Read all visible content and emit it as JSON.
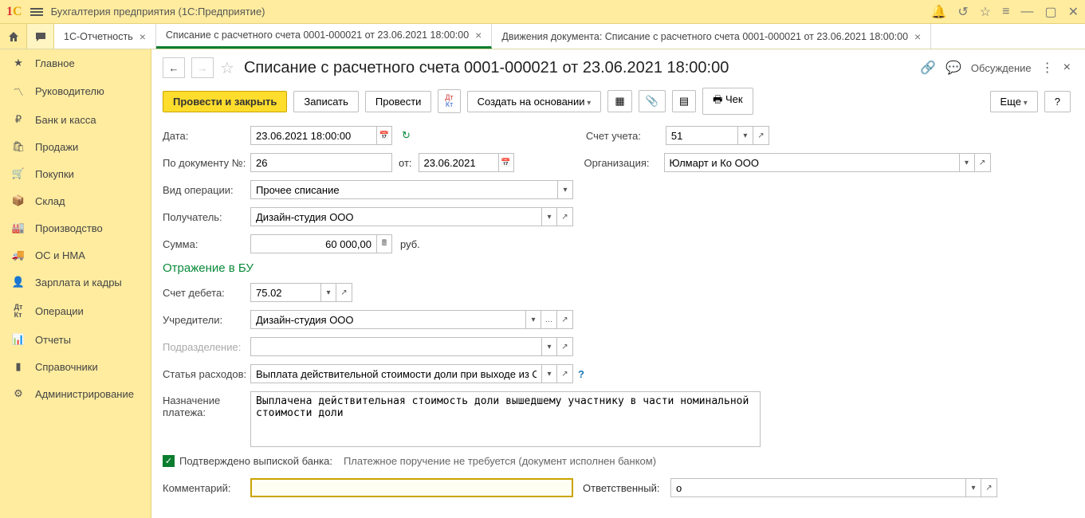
{
  "titlebar": {
    "app_name": "Бухгалтерия предприятия  (1С:Предприятие)"
  },
  "tabs": {
    "t1": "1С-Отчетность",
    "t2": "Списание с расчетного счета 0001-000021 от 23.06.2021 18:00:00",
    "t3": "Движения документа: Списание с расчетного счета 0001-000021 от 23.06.2021 18:00:00"
  },
  "sidebar": {
    "i0": "Главное",
    "i1": "Руководителю",
    "i2": "Банк и касса",
    "i3": "Продажи",
    "i4": "Покупки",
    "i5": "Склад",
    "i6": "Производство",
    "i7": "ОС и НМА",
    "i8": "Зарплата и кадры",
    "i9": "Операции",
    "i10": "Отчеты",
    "i11": "Справочники",
    "i12": "Администрирование"
  },
  "doc": {
    "title": "Списание с расчетного счета 0001-000021 от 23.06.2021 18:00:00",
    "discussion": "Обсуждение"
  },
  "toolbar": {
    "post_close": "Провести и закрыть",
    "record": "Записать",
    "post": "Провести",
    "create_based": "Создать на основании",
    "check": "Чек",
    "more": "Еще",
    "help": "?"
  },
  "labels": {
    "date": "Дата:",
    "account": "Счет учета:",
    "doc_num": "По документу №:",
    "from": "от:",
    "org": "Организация:",
    "op_type": "Вид операции:",
    "recipient": "Получатель:",
    "amount": "Сумма:",
    "rub": "руб.",
    "section_bu": "Отражение в БУ",
    "debit_acc": "Счет дебета:",
    "founders": "Учредители:",
    "division": "Подразделение:",
    "expense_item": "Статья расходов:",
    "purpose": "Назначение платежа:",
    "confirmed": "Подтверждено выпиской банка:",
    "payment_hint": "Платежное поручение не требуется (документ исполнен банком)",
    "comment": "Комментарий:",
    "responsible": "Ответственный:"
  },
  "vals": {
    "date": "23.06.2021 18:00:00",
    "account": "51",
    "doc_num": "26",
    "doc_date": "23.06.2021",
    "org": "Юлмарт и Ко ООО",
    "op_type": "Прочее списание",
    "recipient": "Дизайн-студия ООО",
    "amount": "60 000,00",
    "debit_acc": "75.02",
    "founders": "Дизайн-студия ООО",
    "division": "",
    "expense_item": "Выплата действительной стоимости доли при выходе из ОС",
    "purpose": "Выплачена действительная стоимость доли вышедшему участнику в части номинальной стоимости доли",
    "comment": "",
    "responsible": "о"
  }
}
